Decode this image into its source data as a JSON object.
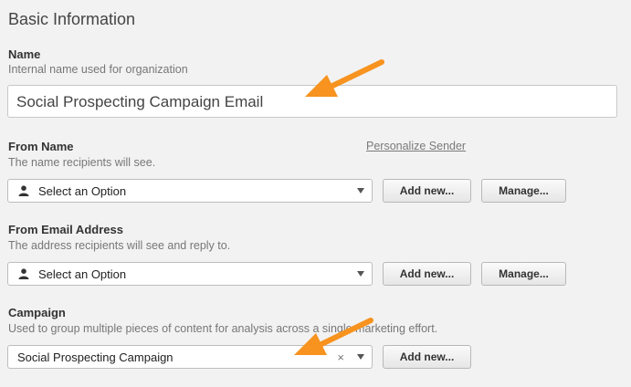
{
  "section": {
    "title": "Basic Information"
  },
  "name": {
    "label": "Name",
    "help": "Internal name used for organization",
    "value": "Social Prospecting Campaign Email"
  },
  "from_name": {
    "label": "From Name",
    "help": "The name recipients will see.",
    "link": "Personalize Sender",
    "select_value": "Select an Option",
    "add_label": "Add new...",
    "manage_label": "Manage..."
  },
  "from_email": {
    "label": "From Email Address",
    "help": "The address recipients will see and reply to.",
    "select_value": "Select an Option",
    "add_label": "Add new...",
    "manage_label": "Manage..."
  },
  "campaign": {
    "label": "Campaign",
    "help": "Used to group multiple pieces of content for analysis across a single marketing effort.",
    "select_value": "Social Prospecting Campaign",
    "clear_glyph": "×",
    "add_label": "Add new..."
  },
  "colors": {
    "accent_arrow": "#f7931e"
  },
  "icons": [
    "person-icon",
    "chevron-down-icon",
    "clear-icon",
    "arrow-annotation"
  ]
}
